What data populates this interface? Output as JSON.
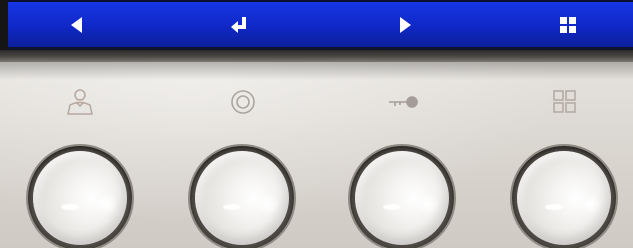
{
  "screen": {
    "background_color": "#1637e6",
    "softkeys": [
      {
        "icon": "left-triangle-icon"
      },
      {
        "icon": "enter-return-icon"
      },
      {
        "icon": "right-triangle-icon"
      },
      {
        "icon": "grid-menu-icon"
      }
    ]
  },
  "panel": {
    "color": "#dad6d0",
    "buttons": [
      {
        "icon": "user-icon"
      },
      {
        "icon": "ring-icon"
      },
      {
        "icon": "key-icon"
      },
      {
        "icon": "grid-menu-icon"
      }
    ]
  }
}
